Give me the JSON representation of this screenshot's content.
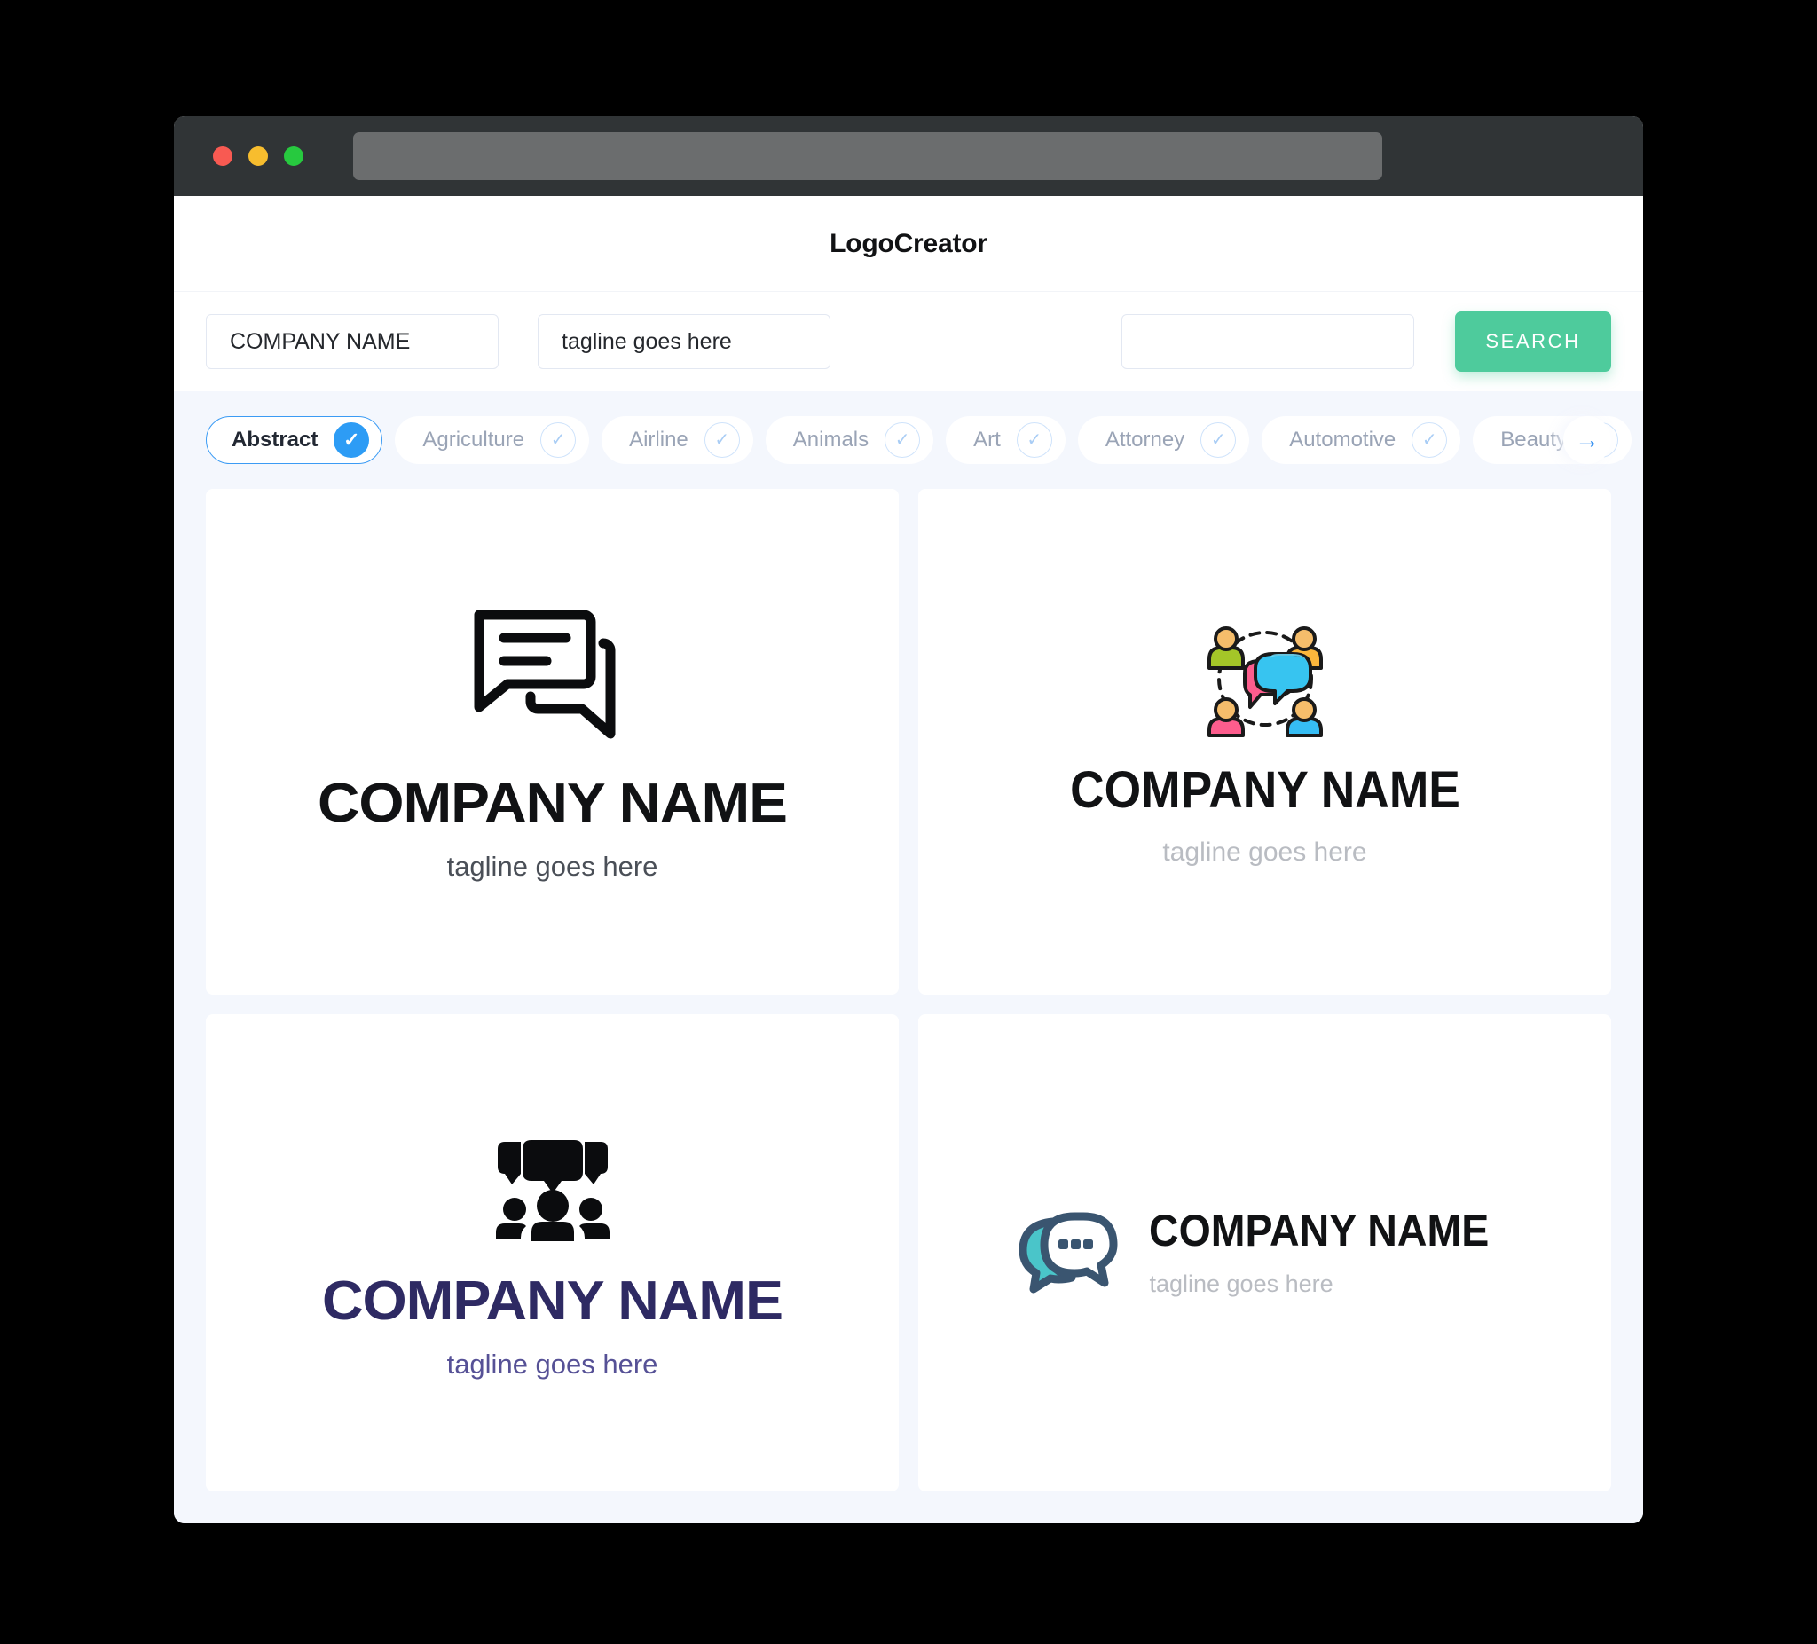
{
  "window": {
    "traffic_lights": [
      "close",
      "minimize",
      "maximize"
    ],
    "url_value": ""
  },
  "header": {
    "title": "LogoCreator"
  },
  "search": {
    "company_value": "COMPANY NAME",
    "company_placeholder": "COMPANY NAME",
    "tagline_value": "tagline goes here",
    "tagline_placeholder": "tagline goes here",
    "keyword_value": "",
    "keyword_placeholder": "",
    "button_label": "SEARCH",
    "button_color": "#4ecb9c"
  },
  "categories": {
    "next_arrow": "→",
    "check_glyph": "✓",
    "selected_color": "#2d9cf5",
    "items": [
      {
        "label": "Abstract",
        "selected": true
      },
      {
        "label": "Agriculture",
        "selected": false
      },
      {
        "label": "Airline",
        "selected": false
      },
      {
        "label": "Animals",
        "selected": false
      },
      {
        "label": "Art",
        "selected": false
      },
      {
        "label": "Attorney",
        "selected": false
      },
      {
        "label": "Automotive",
        "selected": false
      },
      {
        "label": "Beauty",
        "selected": false
      }
    ]
  },
  "logos": [
    {
      "icon": "chat-bubbles-outline-icon",
      "name": "COMPANY NAME",
      "tagline": "tagline goes here",
      "name_color": "#111214",
      "tagline_color": "#4a4f57",
      "layout": "stacked"
    },
    {
      "icon": "people-network-chat-icon",
      "name": "COMPANY NAME",
      "tagline": "tagline goes here",
      "name_color": "#111214",
      "tagline_color": "#b9bcc2",
      "layout": "stacked"
    },
    {
      "icon": "group-speech-solid-icon",
      "name": "COMPANY NAME",
      "tagline": "tagline goes here",
      "name_color": "#2e2a63",
      "tagline_color": "#565196",
      "layout": "stacked"
    },
    {
      "icon": "teal-chat-bubble-dots-icon",
      "name": "COMPANY NAME",
      "tagline": "tagline goes here",
      "name_color": "#111214",
      "tagline_color": "#b9bcc2",
      "layout": "horizontal"
    }
  ]
}
